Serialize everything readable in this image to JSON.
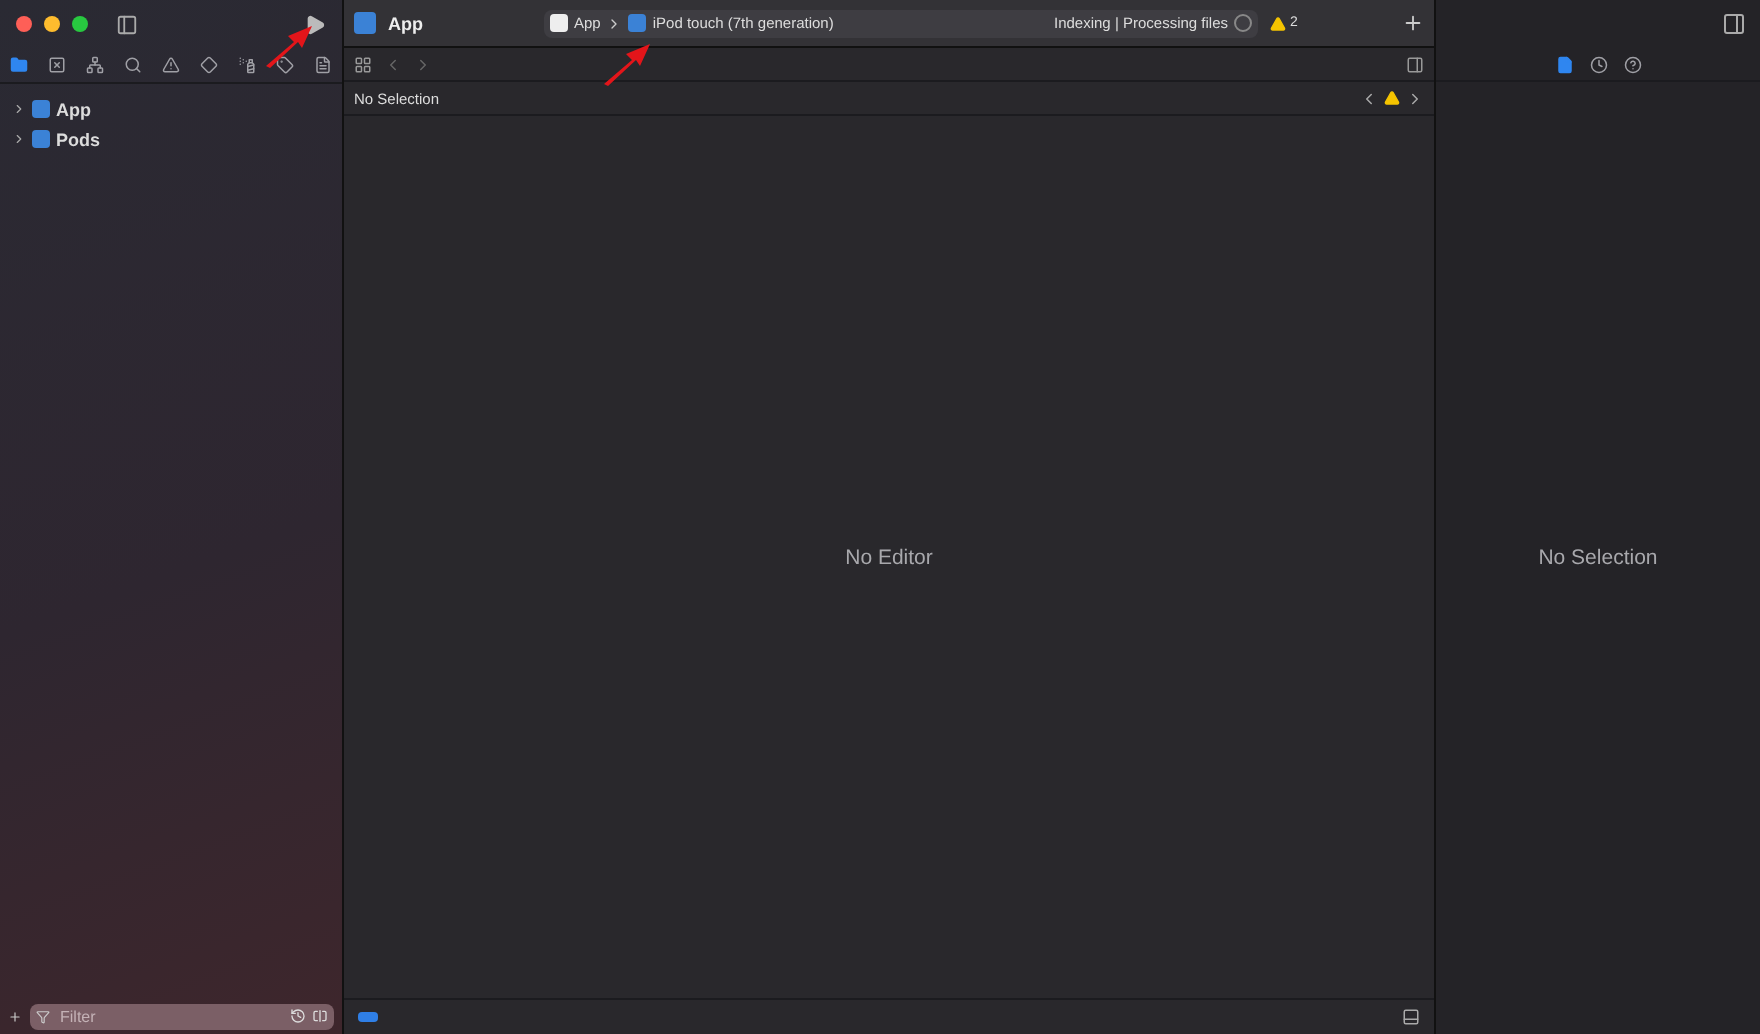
{
  "window": {
    "title": "App"
  },
  "navigator": {
    "tabs": [
      {
        "kind": "folder",
        "selected": true
      },
      {
        "kind": "source-control",
        "selected": false
      },
      {
        "kind": "hierarchy",
        "selected": false
      },
      {
        "kind": "search",
        "selected": false
      },
      {
        "kind": "issues",
        "selected": false
      },
      {
        "kind": "tests",
        "selected": false
      },
      {
        "kind": "debug",
        "selected": false
      },
      {
        "kind": "breakpoints",
        "selected": false
      },
      {
        "kind": "reports",
        "selected": false
      }
    ],
    "items": [
      {
        "label": "App",
        "expanded": false
      },
      {
        "label": "Pods",
        "expanded": false
      }
    ],
    "filter": {
      "placeholder": "Filter"
    }
  },
  "toolbar": {
    "scheme": "App",
    "device": "iPod touch (7th generation)",
    "status": "Indexing | Processing files",
    "warnings": "2"
  },
  "editor": {
    "breadcrumb": "No Selection",
    "message": "No Editor",
    "debug_area": {
      "on": true
    }
  },
  "inspector": {
    "tabs": [
      {
        "kind": "file",
        "selected": true
      },
      {
        "kind": "history",
        "selected": false
      },
      {
        "kind": "help",
        "selected": false
      }
    ],
    "message": "No Selection"
  }
}
